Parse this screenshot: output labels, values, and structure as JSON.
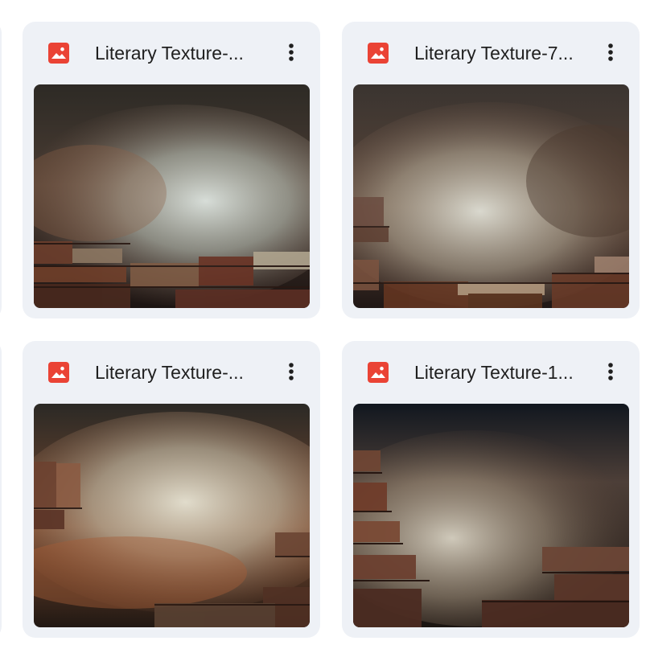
{
  "grid": {
    "files": [
      {
        "name": "Literary Texture-...",
        "type_icon": "image-icon",
        "menu_icon": "more-vert-icon",
        "colors": {
          "top": "#2d2a25",
          "mist": "#cfd4cf",
          "warm": "#9a6548",
          "dark": "#1c1412"
        }
      },
      {
        "name": "Literary Texture-7...",
        "type_icon": "image-icon",
        "menu_icon": "more-vert-icon",
        "colors": {
          "top": "#3a3430",
          "mist": "#d4d3c9",
          "warm": "#8e5f46",
          "dark": "#201715"
        }
      },
      {
        "name": "Literary Texture-...",
        "type_icon": "image-icon",
        "menu_icon": "more-vert-icon",
        "colors": {
          "top": "#2b2925",
          "mist": "#ccc9b8",
          "warm": "#a35d38",
          "dark": "#211813"
        }
      },
      {
        "name": "Literary Texture-1...",
        "type_icon": "image-icon",
        "menu_icon": "more-vert-icon",
        "colors": {
          "top": "#11171f",
          "mist": "#c6c3b7",
          "warm": "#8c5b43",
          "dark": "#1b1512"
        }
      }
    ]
  },
  "theme": {
    "card_background": "#eef1f6",
    "image_icon_color": "#ea4335",
    "text_color": "#1f1f1f",
    "menu_icon_color": "#1f1f1f"
  }
}
